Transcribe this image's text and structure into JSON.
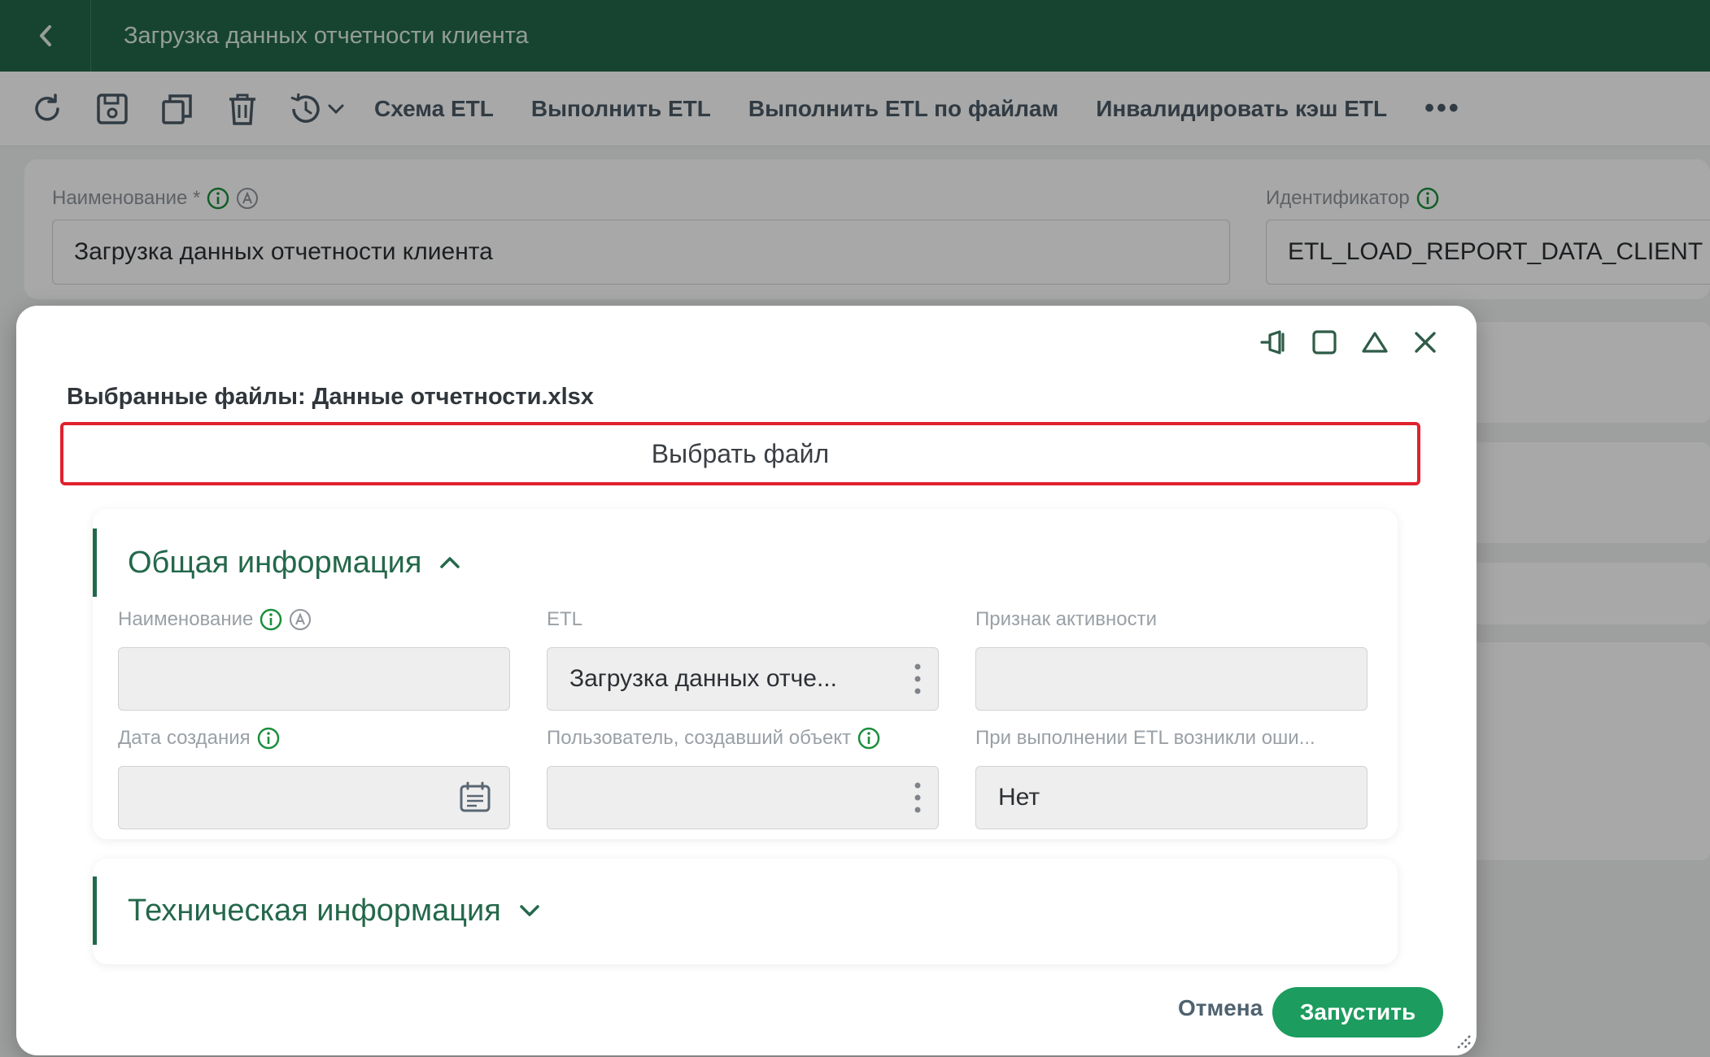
{
  "colors": {
    "brand": "#24684b",
    "run_button": "#1c9c5f",
    "highlight_border": "#e0222e",
    "info_icon": "#1a8f3c"
  },
  "header": {
    "title": "Загрузка данных отчетности клиента",
    "back_icon": "chevron-left-icon"
  },
  "toolbar": {
    "icons": [
      "refresh-icon",
      "save-icon",
      "copy-icon",
      "trash-icon",
      "history-icon"
    ],
    "links": {
      "etl_schema": "Схема ETL",
      "run_etl": "Выполнить ETL",
      "run_etl_files": "Выполнить ETL по файлам",
      "invalidate_cache": "Инвалидировать кэш ETL"
    },
    "more": "•••"
  },
  "form": {
    "name_label": "Наименование *",
    "name_value": "Загрузка данных отчетности клиента",
    "id_label": "Идентификатор",
    "id_value": "ETL_LOAD_REPORT_DATA_CLIENT"
  },
  "modal": {
    "controls": [
      "pin-icon",
      "maximize-icon",
      "collapse-icon",
      "close-icon"
    ],
    "selected_files": "Выбранные файлы: Данные отчетности.xlsx",
    "choose_file": "Выбрать файл",
    "general": {
      "title": "Общая информация",
      "fields": {
        "name_label": "Наименование",
        "name_value": "",
        "etl_label": "ETL",
        "etl_value": "Загрузка данных отче...",
        "active_label": "Признак активности",
        "active_value": "",
        "created_label": "Дата создания",
        "created_value": "",
        "creator_label": "Пользователь, создавший объект",
        "creator_value": "",
        "errors_label": "При выполнении ETL возникли оши...",
        "errors_value": "Нет"
      }
    },
    "technical": {
      "title": "Техническая информация"
    },
    "cancel": "Отмена",
    "run": "Запустить"
  }
}
